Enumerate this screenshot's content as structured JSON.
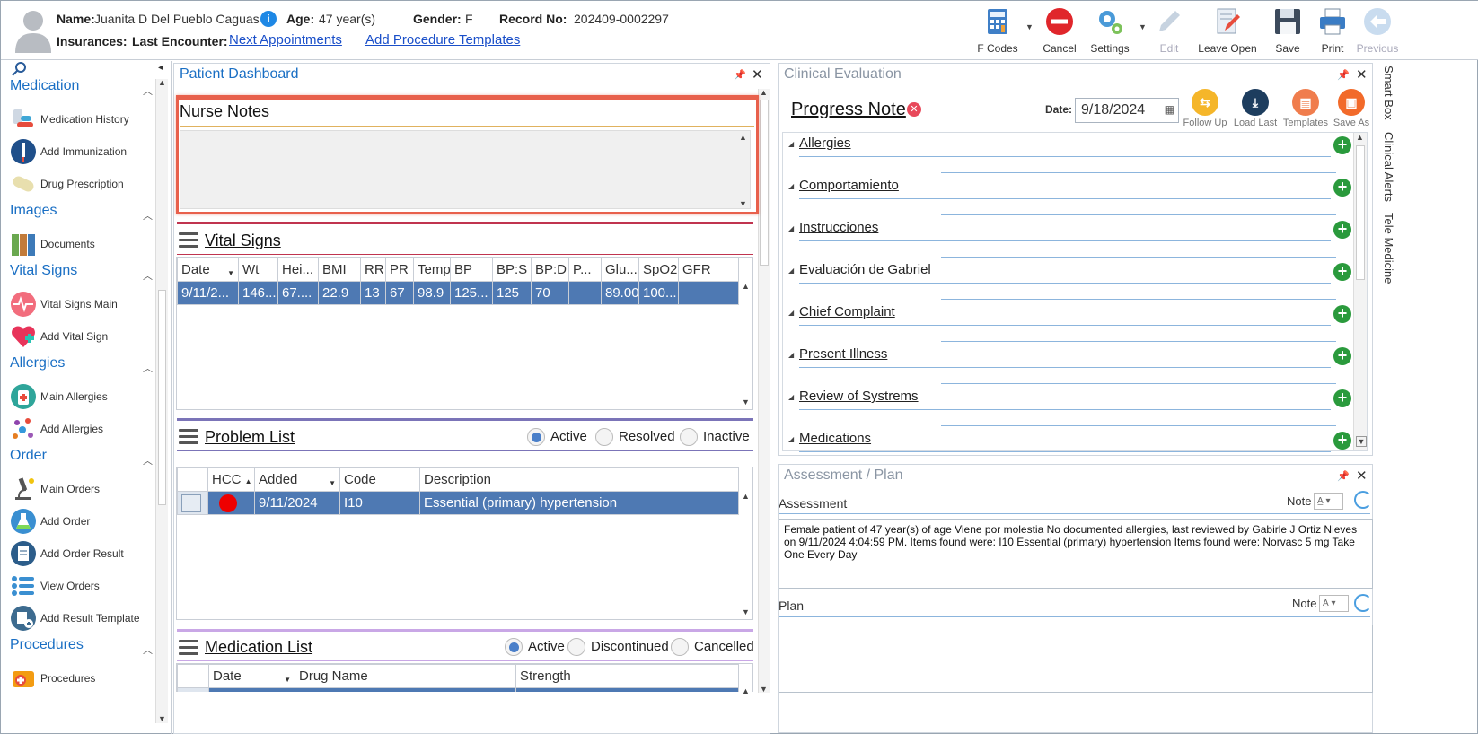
{
  "header": {
    "name_label": "Name:",
    "name_value": "Juanita D Del Pueblo Caguas",
    "age_label": "Age:",
    "age_value": "47 year(s)",
    "gender_label": "Gender:",
    "gender_value": "F",
    "record_label": "Record No:",
    "record_value": "202409-0002297",
    "insurances_label": "Insurances:",
    "last_encounter_label": "Last Encounter:",
    "next_appointments_link": "Next Appointments",
    "add_procedure_templates_link": "Add Procedure Templates"
  },
  "toolbar": {
    "f_codes": "F Codes",
    "cancel": "Cancel",
    "settings": "Settings",
    "edit": "Edit",
    "leave_open": "Leave Open",
    "save": "Save",
    "print": "Print",
    "previous": "Previous"
  },
  "sidebar": {
    "medication": {
      "title": "Medication",
      "items": [
        "Medication History",
        "Add Immunization",
        "Drug Prescription"
      ]
    },
    "images": {
      "title": "Images",
      "items": [
        "Documents"
      ]
    },
    "vitals": {
      "title": "Vital Signs",
      "items": [
        "Vital Signs Main",
        "Add Vital Sign"
      ]
    },
    "allergies": {
      "title": "Allergies",
      "items": [
        "Main Allergies",
        "Add Allergies"
      ]
    },
    "order": {
      "title": "Order",
      "items": [
        "Main Orders",
        "Add Order",
        "Add Order Result",
        "View Orders",
        "Add Result Template"
      ]
    },
    "procedures": {
      "title": "Procedures",
      "items": [
        "Procedures"
      ]
    }
  },
  "dashboard": {
    "title": "Patient Dashboard",
    "nurse_notes": "Nurse Notes",
    "vital_signs": {
      "title": "Vital Signs",
      "columns": [
        "Date",
        "Wt",
        "Hei...",
        "BMI",
        "RR",
        "PR",
        "Temp",
        "BP",
        "BP:S",
        "BP:D",
        "P...",
        "Glu...",
        "SpO2",
        "GFR"
      ],
      "rows": [
        [
          "9/11/2...",
          "146...",
          "67....",
          "22.9",
          "13",
          "67",
          "98.9",
          "125...",
          "125",
          "70",
          "",
          "89.00",
          "100...",
          ""
        ]
      ]
    },
    "problem_list": {
      "title": "Problem List",
      "filters": [
        "Active",
        "Resolved",
        "Inactive"
      ],
      "columns": [
        "HCC",
        "Added",
        "Code",
        "Description"
      ],
      "rows": [
        [
          "",
          "9/11/2024",
          "I10",
          "Essential (primary) hypertension"
        ]
      ]
    },
    "medication_list": {
      "title": "Medication List",
      "filters": [
        "Active",
        "Discontinued",
        "Cancelled"
      ],
      "columns": [
        "Date",
        "Drug Name",
        "Strength"
      ]
    }
  },
  "clinical": {
    "title": "Clinical Evaluation",
    "note_title": "Progress Note",
    "date_label": "Date:",
    "date_value": "9/18/2024",
    "tools": [
      "Follow Up",
      "Load Last",
      "Templates",
      "Save As"
    ],
    "sections": [
      "Allergies",
      "Comportamiento",
      "Instrucciones",
      "Evaluación de Gabriel",
      "Chief Complaint",
      "Present Illness",
      "Review of Systrems",
      "Medications"
    ]
  },
  "assessment": {
    "title": "Assessment / Plan",
    "assessment_label": "Assessment",
    "note_label": "Note",
    "assessment_text": "Female patient of 47 year(s) of age Viene por molestia     No documented allergies, last reviewed by Gabirle J Ortiz Nieves on 9/11/2024 4:04:59 PM.     Items found were:  I10 Essential (primary) hypertension  Items found were:  Norvasc 5 mg Take One Every Day",
    "plan_label": "Plan",
    "plan_note_label": "Note"
  },
  "right_tabs": [
    "Smart Box",
    "Clinical Alerts",
    "Tele Medicine"
  ],
  "colors": {
    "accent": "#1a6fc4",
    "selection": "#4e79b3",
    "nurse_border": "#e8604c",
    "add_green": "#2a9a3c"
  }
}
